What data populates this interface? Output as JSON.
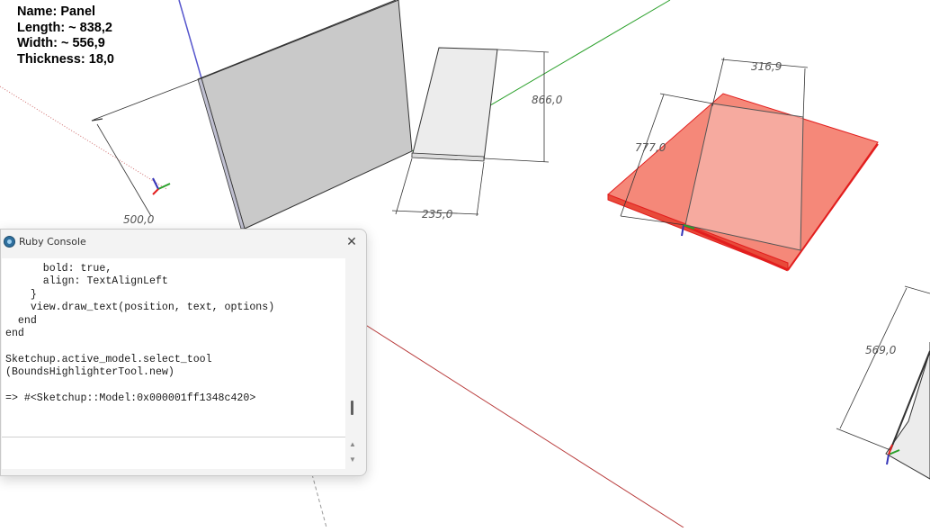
{
  "model_info": {
    "name": "Name: Panel",
    "length": "Length: ~ 838,2",
    "width": "Width: ~ 556,9",
    "thickness": "Thickness: 18,0"
  },
  "dimensions": {
    "d1": "500,0",
    "d2": "866,0",
    "d3": "235,0",
    "d4": "316,9",
    "d5": "777,0",
    "d6": "569,0"
  },
  "ruby_console": {
    "title": "Ruby Console",
    "close_glyph": "✕",
    "output": "      bold: true,\n      align: TextAlignLeft\n    }\n    view.draw_text(position, text, options)\n  end\nend\n\nSketchup.active_model.select_tool\n(BoundsHighlighterTool.new)\n\n=> #<Sketchup::Model:0x000001ff1348c420>",
    "input_value": "",
    "scroll_up_glyph": "▲",
    "scroll_down_glyph": "▼"
  },
  "colors": {
    "highlight_fill": "#f47766",
    "highlight_edge": "#e21e1e",
    "green_axis": "#2aa02a",
    "red_axis": "#b83a3a",
    "blue_axis": "#3434b8",
    "panel_gray": "#c9c9c9"
  }
}
